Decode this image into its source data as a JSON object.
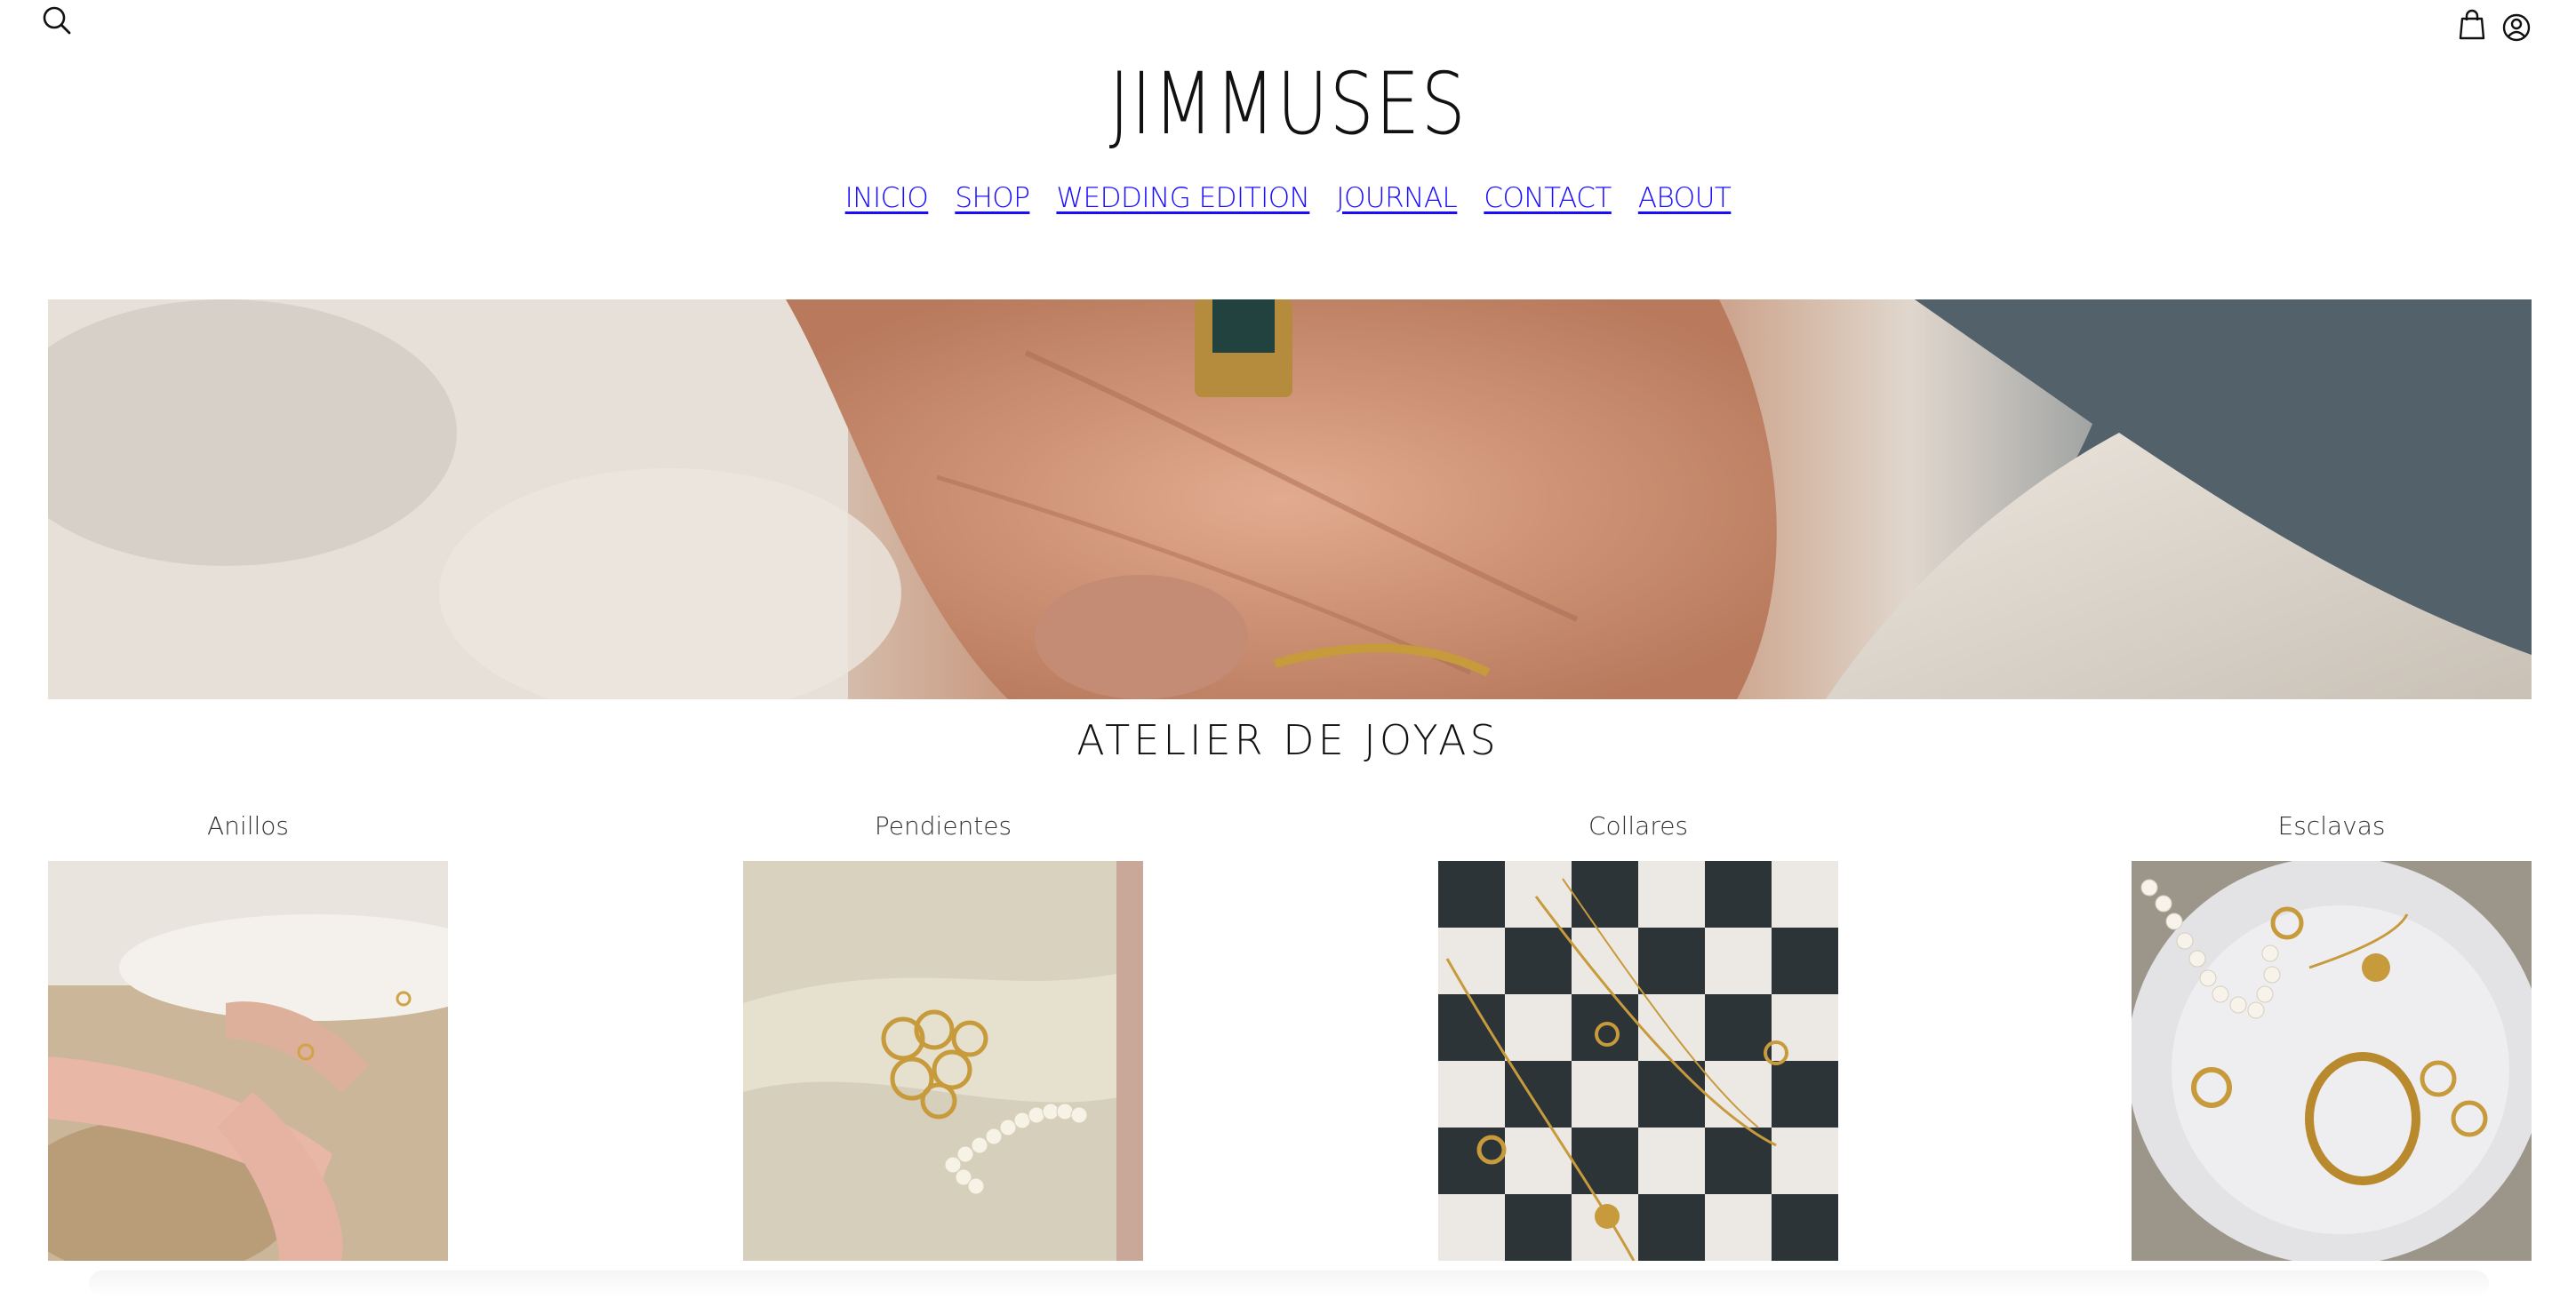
{
  "header": {
    "brand": "JIMMUSES",
    "icons": {
      "search": "search-icon",
      "cart": "shopping-bag-icon",
      "account": "user-circle-icon"
    }
  },
  "nav": {
    "items": [
      {
        "label": "INICIO"
      },
      {
        "label": "SHOP"
      },
      {
        "label": "WEDDING EDITION"
      },
      {
        "label": "JOURNAL"
      },
      {
        "label": "CONTACT"
      },
      {
        "label": "ABOUT"
      }
    ],
    "link_color": "#1a0dff"
  },
  "section": {
    "title": "ATELIER DE JOYAS"
  },
  "categories": [
    {
      "label": "Anillos"
    },
    {
      "label": "Pendientes"
    },
    {
      "label": "Collares"
    },
    {
      "label": "Esclavas"
    }
  ]
}
